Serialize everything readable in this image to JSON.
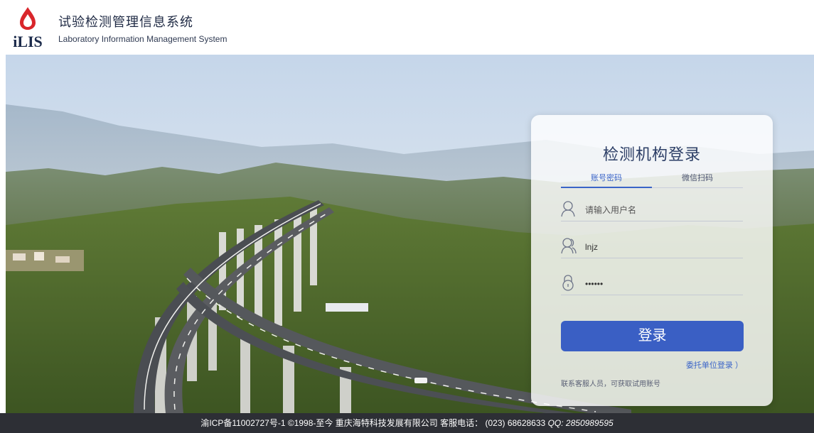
{
  "header": {
    "logo_text": "iLIS",
    "system_title": "试验检测管理信息系统",
    "system_subtitle": "Laboratory Information Management System"
  },
  "login": {
    "title": "检测机构登录",
    "tabs": [
      {
        "label": "账号密码",
        "active": true
      },
      {
        "label": "微信扫码",
        "active": false
      }
    ],
    "username_placeholder": "请输入用户名",
    "name_value": "lnjz",
    "password_value": "••••••",
    "submit_label": "登录",
    "client_login_label": "委托单位登录 ）",
    "contact_note": "联系客服人员，可获取试用账号"
  },
  "footer": {
    "icp": "渝ICP备11002727号-1",
    "copyright": "©1998-至今",
    "company": "重庆海特科技发展有限公司",
    "service_label": "客服电话：",
    "phone": "(023)  68628633",
    "qq_label": "QQ:",
    "qq_number": "2850989595"
  },
  "colors": {
    "accent": "#3a5fc4",
    "tab_active": "#3a64c8",
    "footer_bg": "#2d2f35",
    "logo_red": "#d9262b"
  },
  "icons": {
    "username": "user-outline-icon",
    "name": "users-outline-icon",
    "password": "lock-outline-icon"
  }
}
